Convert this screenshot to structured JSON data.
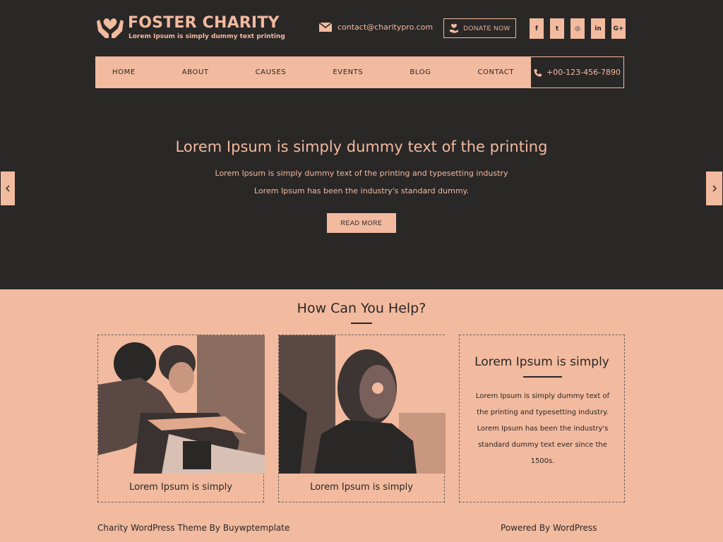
{
  "header": {
    "brand": "FOSTER CHARITY",
    "tagline": "Lorem Ipsum is simply dummy text printing",
    "email": "contact@charitypro.com",
    "donate_label": "DONATE NOW",
    "social": [
      {
        "icon": "facebook-icon",
        "glyph": "f"
      },
      {
        "icon": "twitter-icon",
        "glyph": "t"
      },
      {
        "icon": "instagram-icon",
        "glyph": "◎"
      },
      {
        "icon": "linkedin-icon",
        "glyph": "in"
      },
      {
        "icon": "google-plus-icon",
        "glyph": "G+"
      }
    ]
  },
  "nav": {
    "items": [
      "HOME",
      "ABOUT",
      "CAUSES",
      "EVENTS",
      "BLOG",
      "CONTACT"
    ],
    "phone": "+00-123-456-7890"
  },
  "hero": {
    "title": "Lorem Ipsum is simply dummy text of the printing",
    "line1": "Lorem Ipsum is simply dummy text of the printing and typesetting industry",
    "line2": "Lorem Ipsum has been the industry's standard dummy.",
    "button": "READ MORE"
  },
  "help": {
    "title": "How Can You Help?",
    "cards": [
      {
        "title": "Lorem Ipsum is simply"
      },
      {
        "title": "Lorem Ipsum is simply"
      }
    ],
    "info_card": {
      "title": "Lorem Ipsum is simply",
      "text": "Lorem Ipsum is simply dummy text of the printing and typesetting industry. Lorem Ipsum has been the industry's standard dummy text ever since the 1500s."
    }
  },
  "footer": {
    "left": "Charity WordPress Theme By Buywptemplate",
    "right": "Powered By WordPress"
  },
  "colors": {
    "dark": "#2a2727",
    "accent": "#f2ba9e"
  }
}
